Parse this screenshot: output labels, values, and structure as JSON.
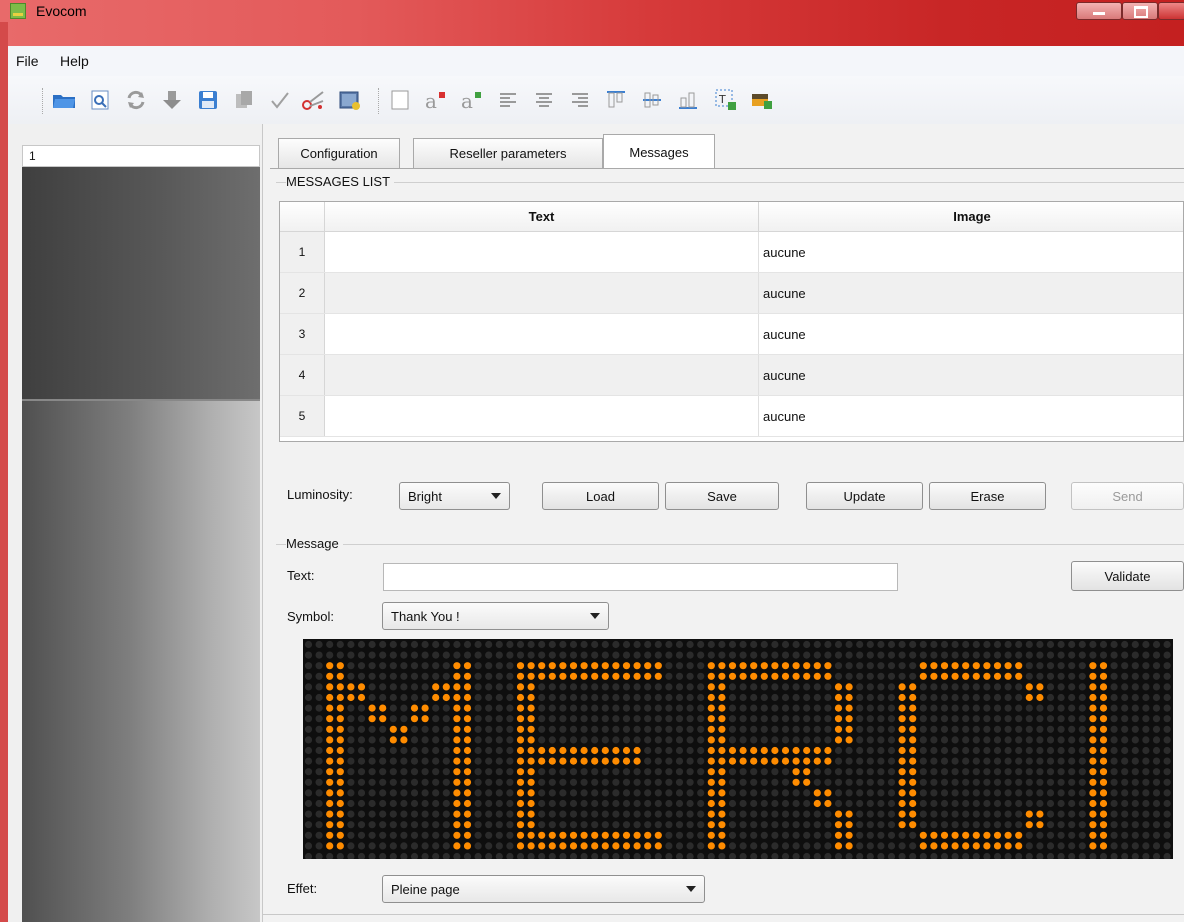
{
  "window": {
    "title": "Evocom"
  },
  "menu": {
    "items": [
      "File",
      "Help"
    ]
  },
  "toolbar": {
    "icons": [
      "open-folder-icon",
      "preview-icon",
      "refresh-icon",
      "download-icon",
      "save-disk-icon",
      "copy-icon",
      "check-icon",
      "scissors-icon",
      "image-settings-icon",
      "blank-page-icon",
      "text-color-red-icon",
      "text-color-green-icon",
      "align-left-icon",
      "align-center-icon",
      "align-right-icon",
      "align-top-icon",
      "align-middle-icon",
      "align-bottom-icon",
      "insert-text-icon",
      "insert-image-icon"
    ]
  },
  "left": {
    "selected_item": "1"
  },
  "tabs": [
    {
      "label": "Configuration"
    },
    {
      "label": "Reseller parameters"
    },
    {
      "label": "Messages"
    }
  ],
  "messages_list": {
    "group_label": "MESSAGES LIST",
    "columns": [
      "Text",
      "Image"
    ],
    "rows": [
      {
        "num": "1",
        "text": "",
        "image": "aucune"
      },
      {
        "num": "2",
        "text": "",
        "image": "aucune"
      },
      {
        "num": "3",
        "text": "",
        "image": "aucune"
      },
      {
        "num": "4",
        "text": "",
        "image": "aucune"
      },
      {
        "num": "5",
        "text": "",
        "image": "aucune"
      }
    ]
  },
  "controls": {
    "luminosity_label": "Luminosity:",
    "luminosity_value": "Bright",
    "load": "Load",
    "save": "Save",
    "update": "Update",
    "erase": "Erase",
    "send": "Send"
  },
  "message": {
    "group_label": "Message",
    "text_label": "Text:",
    "text_value": "",
    "validate": "Validate",
    "symbol_label": "Symbol:",
    "symbol_value": "Thank You !",
    "effect_label": "Effet:",
    "effect_value": "Pleine page"
  },
  "led_display": {
    "text": "MERCI",
    "led_color": "#ff8c00",
    "off_color": "#2b2b2b"
  }
}
